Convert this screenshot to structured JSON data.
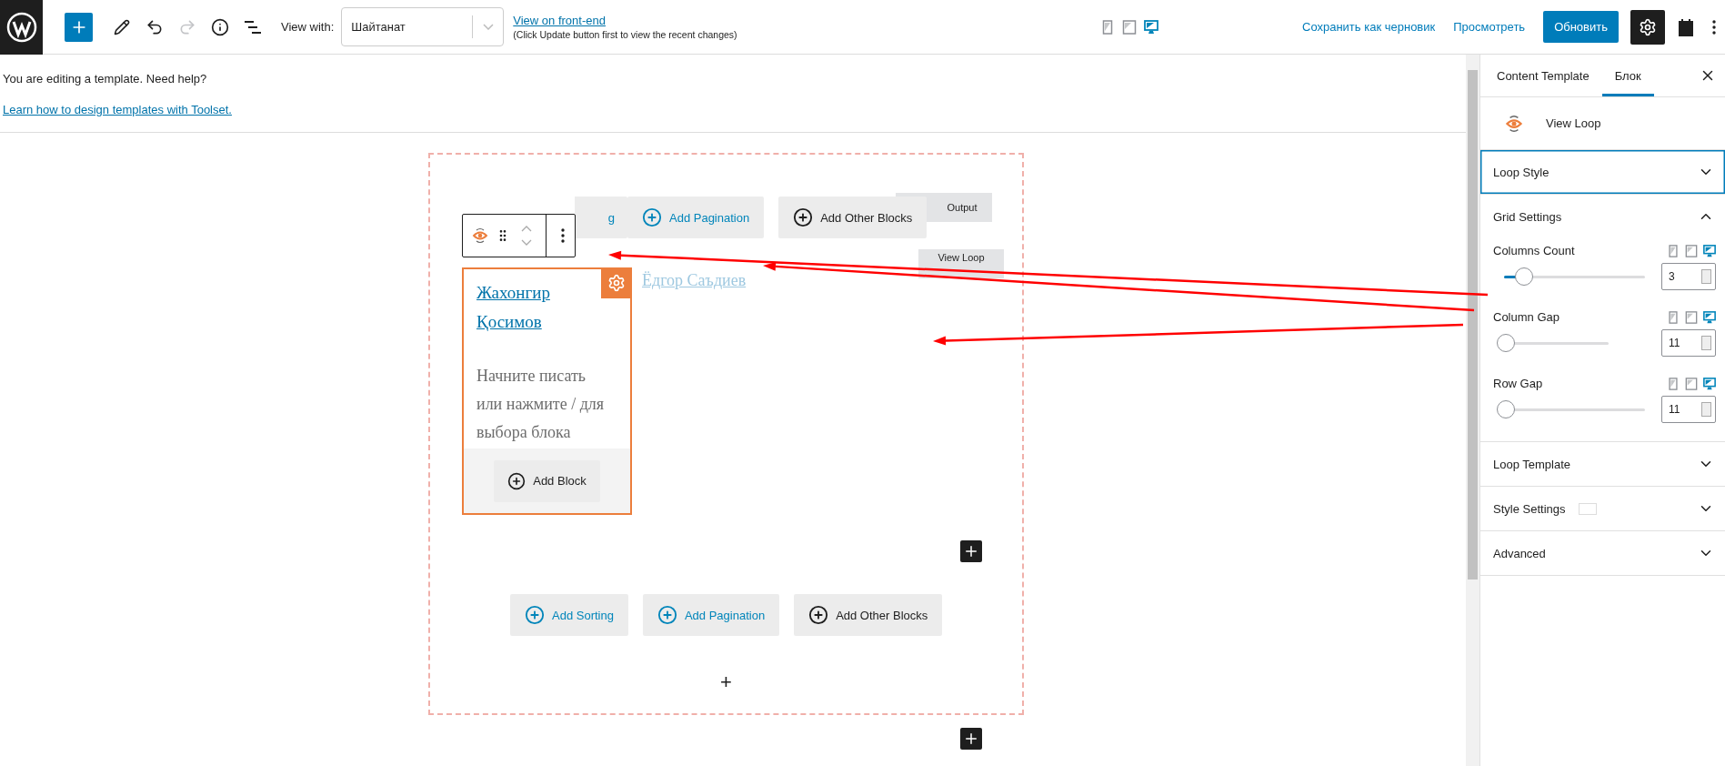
{
  "toolbar": {
    "redo_disabled": true,
    "view_with_label": "View with:",
    "view_with_value": "Шайтанат",
    "front_end_link": "View on front-end",
    "front_end_note": "(Click Update button first to view the recent changes)",
    "devices": [
      {
        "kind": "mobile",
        "selected": false
      },
      {
        "kind": "tablet",
        "selected": false
      },
      {
        "kind": "desktop",
        "selected": true
      }
    ],
    "save_draft": "Сохранить как черновик",
    "preview": "Просмотреть",
    "update": "Обновить",
    "settings_open": true
  },
  "notice": {
    "text": "You are editing a template. Need help?",
    "link": "Learn how to design templates with Toolset."
  },
  "canvas": {
    "partial_button": {
      "label": "g"
    },
    "top_buttons": [
      {
        "kind": "pagination",
        "label": "Add Pagination"
      },
      {
        "kind": "other",
        "label": "Add Other Blocks"
      }
    ],
    "output_label": "Output",
    "view_loop_label": "View Loop",
    "card": {
      "title": "Жахонгир Қосимов",
      "placeholder": "Начните писать или нажмите / для выбора блока",
      "add_block": "Add Block"
    },
    "next_item_link": "Ёдгор Саъдиев",
    "bottom_buttons": [
      {
        "kind": "sorting",
        "label": "Add Sorting"
      },
      {
        "kind": "pagination",
        "label": "Add Pagination"
      },
      {
        "kind": "other",
        "label": "Add Other Blocks"
      }
    ],
    "append_symbol": "+"
  },
  "sidebar": {
    "tabs": [
      {
        "label": "Content Template",
        "selected": false
      },
      {
        "label": "Блок",
        "selected": true
      }
    ],
    "block_name": "View Loop",
    "panels": [
      {
        "title": "Loop Style",
        "expanded": false,
        "focused": true
      },
      {
        "title": "Grid Settings",
        "expanded": true,
        "focused": false,
        "controls": [
          {
            "label": "Columns Count",
            "level": 0.13,
            "value": "3",
            "short_track": false,
            "devices": [
              {
                "kind": "mobile",
                "selected": false
              },
              {
                "kind": "tablet",
                "selected": false
              },
              {
                "kind": "desktop",
                "selected": true
              }
            ]
          },
          {
            "label": "Column Gap",
            "level": 0,
            "value": "11",
            "short_track": true,
            "devices": [
              {
                "kind": "mobile",
                "selected": false
              },
              {
                "kind": "tablet",
                "selected": false
              },
              {
                "kind": "desktop",
                "selected": true
              }
            ]
          },
          {
            "label": "Row Gap",
            "level": 0,
            "value": "11",
            "short_track": false,
            "devices": [
              {
                "kind": "mobile",
                "selected": false
              },
              {
                "kind": "tablet",
                "selected": false
              },
              {
                "kind": "desktop",
                "selected": true
              }
            ]
          }
        ]
      },
      {
        "title": "Loop Template",
        "expanded": false,
        "focused": false
      },
      {
        "title": "Style Settings",
        "expanded": false,
        "focused": false,
        "swatch": true
      },
      {
        "title": "Advanced",
        "expanded": false,
        "focused": false
      }
    ]
  }
}
